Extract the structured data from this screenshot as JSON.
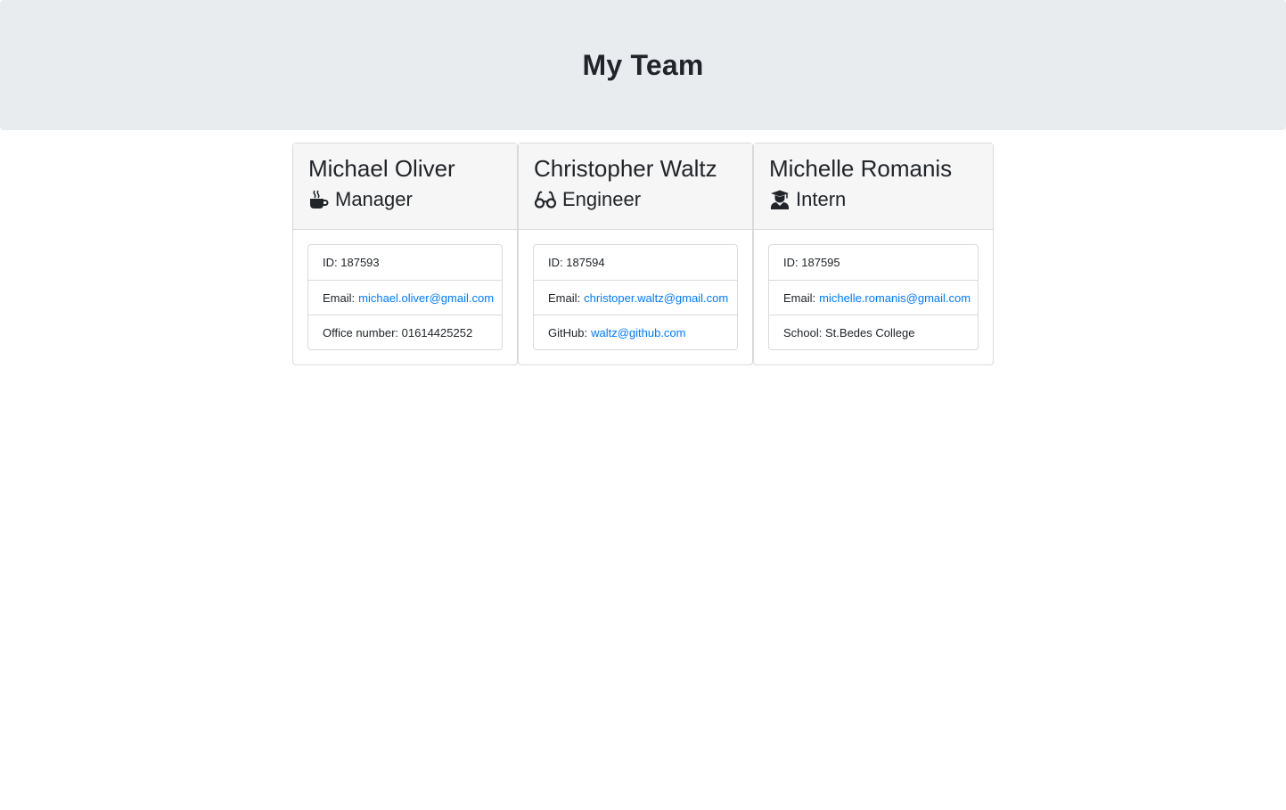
{
  "header": {
    "title": "My Team"
  },
  "team": [
    {
      "name": "Michael Oliver",
      "role": "Manager",
      "icon": "coffee-mug-icon",
      "id_label": "ID:",
      "id": "187593",
      "email_label": "Email:",
      "email": "michael.oliver@gmail.com",
      "extra_label": "Office number:",
      "extra": "01614425252"
    },
    {
      "name": "Christopher Waltz",
      "role": "Engineer",
      "icon": "glasses-icon",
      "id_label": "ID:",
      "id": "187594",
      "email_label": "Email:",
      "email": "christoper.waltz@gmail.com",
      "extra_label": "GitHub:",
      "extra": "waltz@github.com"
    },
    {
      "name": "Michelle Romanis",
      "role": "Intern",
      "icon": "graduate-icon",
      "id_label": "ID:",
      "id": "187595",
      "email_label": "Email:",
      "email": "michelle.romanis@gmail.com",
      "extra_label": "School:",
      "extra": "St.Bedes College"
    }
  ],
  "colors": {
    "link": "#007bff",
    "jumbotron": "#e9ecef",
    "card_header": "#f6f6f6"
  }
}
